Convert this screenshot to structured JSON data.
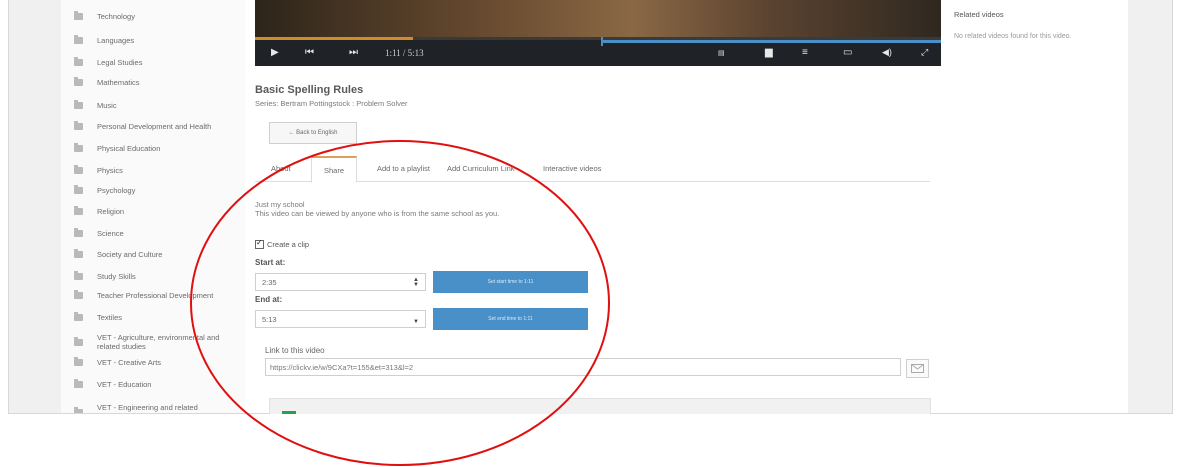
{
  "sidebar": {
    "items": [
      {
        "label": "Technology",
        "icon": "folder-icon"
      },
      {
        "label": "Languages",
        "icon": "folder-icon"
      },
      {
        "label": "Legal Studies",
        "icon": "folder-icon"
      },
      {
        "label": "Mathematics",
        "icon": "folder-icon"
      },
      {
        "label": "Music",
        "icon": "folder-icon"
      },
      {
        "label": "Personal Development and Health",
        "icon": "folder-icon"
      },
      {
        "label": "Physical Education",
        "icon": "folder-icon"
      },
      {
        "label": "Physics",
        "icon": "folder-icon"
      },
      {
        "label": "Psychology",
        "icon": "folder-icon"
      },
      {
        "label": "Religion",
        "icon": "folder-icon"
      },
      {
        "label": "Science",
        "icon": "folder-icon"
      },
      {
        "label": "Society and Culture",
        "icon": "folder-icon"
      },
      {
        "label": "Study Skills",
        "icon": "folder-icon"
      },
      {
        "label": "Teacher Professional Development",
        "icon": "folder-icon"
      },
      {
        "label": "Textiles",
        "icon": "folder-icon"
      },
      {
        "label": "VET - Agriculture, environmental and related studies",
        "icon": "folder-icon"
      },
      {
        "label": "VET - Creative Arts",
        "icon": "folder-icon"
      },
      {
        "label": "VET - Education",
        "icon": "folder-icon"
      },
      {
        "label": "VET - Engineering and related technologies",
        "icon": "folder-icon"
      }
    ]
  },
  "player": {
    "time": "1:11 / 5:13",
    "progress_fraction": 0.23,
    "icons": [
      "play-icon",
      "skip-back-icon",
      "skip-forward-icon",
      "captions-icon",
      "bookmark-icon",
      "list-icon",
      "screen-icon",
      "volume-icon",
      "fullscreen-icon"
    ]
  },
  "video": {
    "title": "Basic Spelling Rules",
    "series": "Series: Bertram Pottingstock : Problem Solver",
    "back_label": "← Back to English"
  },
  "tabs": [
    {
      "label": "About"
    },
    {
      "label": "Share"
    },
    {
      "label": "Add to a playlist"
    },
    {
      "label": "Add Curriculum Link"
    },
    {
      "label": "Interactive videos"
    }
  ],
  "share": {
    "privacy_title": "Just my school",
    "privacy_desc": "This video can be viewed by anyone who is from the same school as you.",
    "clip_label": "Create a clip",
    "start_label": "Start at:",
    "start_value": "2:35",
    "start_button": "Set start time to 1:11",
    "end_label": "End at:",
    "end_value": "5:13",
    "end_button": "Set end time to 1:11",
    "link_label": "Link to this video",
    "link_value": "https://clickv.ie/w/9CXa?t=155&et=313&l=2"
  },
  "related": {
    "title": "Related videos",
    "empty_text": "No related videos found for this video."
  },
  "annotation": {
    "color": "#e01010",
    "shape": "ellipse"
  }
}
